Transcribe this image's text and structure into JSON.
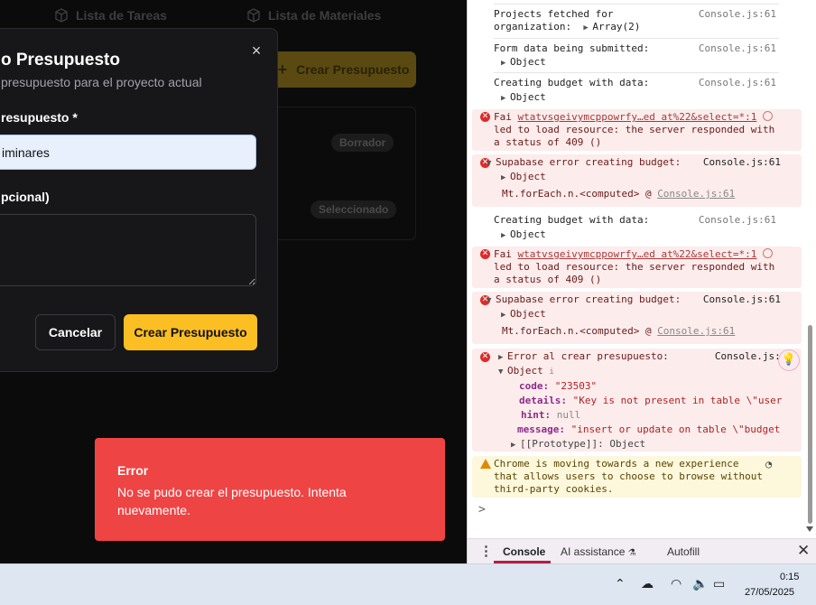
{
  "app": {
    "tabs": [
      "Lista de Tareas",
      "Lista de Materiales"
    ],
    "create_button": "Crear Presupuesto",
    "badges": [
      "Borrador",
      "Seleccionado"
    ]
  },
  "dialog": {
    "title": "o Presupuesto",
    "description": "presupuesto para el proyecto actual",
    "name_label": "resupuesto *",
    "name_value": "iminares",
    "notes_label": "pcional)",
    "notes_value": "",
    "cancel_label": "Cancelar",
    "submit_label": "Crear Presupuesto",
    "close_icon": "×"
  },
  "toast": {
    "title": "Error",
    "message": "No se pudo crear el presupuesto. Intenta nuevamente."
  },
  "console": {
    "source": "Console.js:61",
    "m1_line1": "Projects fetched for",
    "m1_line2": "organization:",
    "m1_value": "Array(2)",
    "m2_text": "Form data being submitted:",
    "m2_value": "Object",
    "m3_text": "Creating budget with data:",
    "m3_value": "Object",
    "e1_prefix": "Fai ",
    "e1_link": "wtatvsgeivymcppowrfy…ed at%22&select=*:1",
    "e1_line2": "led to load resource: the server responded with",
    "e1_line3": "a status of 409 ()",
    "e2_text": "Supabase error creating budget:",
    "e2_value": "Object",
    "e2_stack": "Mt.forEach.n.<computed> @ ",
    "m4_text": "Creating budget with data:",
    "m4_value": "Object",
    "e5_text": "Error al crear presupuesto:",
    "e5_value": "Object",
    "e5_code_key": "code:",
    "e5_code_val": "\"23503\"",
    "e5_details_key": "details:",
    "e5_details_val": "\"Key is not present in table \\\"user",
    "e5_hint_key": "hint:",
    "e5_hint_val": "null",
    "e5_message_key": "message:",
    "e5_message_val": "\"insert or update on table \\\"budget",
    "e5_proto": "[[Prototype]]: Object",
    "warn_line1": "Chrome is moving towards a new experience",
    "warn_line2": "that allows users to choose to browse without",
    "warn_line3": "third-party cookies.",
    "prompt": ">"
  },
  "drawer": {
    "tabs": [
      "Console",
      "AI assistance",
      "Autofill"
    ]
  },
  "taskbar": {
    "time": "0:15",
    "date": "27/05/2025"
  }
}
